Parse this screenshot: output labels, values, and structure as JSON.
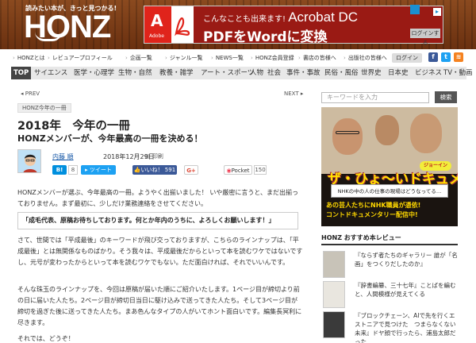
{
  "header": {
    "tagline": "読みたい本が、きっと見つかる!",
    "logo": "HONZ",
    "ad": {
      "brand": "Adobe",
      "line1_prefix": "こんなことも出来ます!",
      "line1_product": "Acrobat DC",
      "line2": "PDFをWordに変換"
    },
    "login_top": "ログインする"
  },
  "topnav": {
    "items": [
      "HONZとは",
      "レビュアープロフィール",
      "企画一覧",
      "ジャンル一覧",
      "NEWS一覧",
      "HONZ会員登録",
      "書店の皆様へ",
      "出版社の皆様へ"
    ],
    "login": "ログイン"
  },
  "categories": [
    "TOP",
    "サイエンス",
    "医学・心理学",
    "生物・自然",
    "教養・雑学",
    "アート・スポーツ",
    "人物",
    "社会",
    "事件・事故",
    "民俗・風俗",
    "世界史",
    "日本史",
    "ビジネス",
    "TV・動画"
  ],
  "pager": {
    "prev": "PREV",
    "next": "NEXT"
  },
  "article": {
    "tag": "HONZ今年の一冊",
    "title": "2018年　今年の一冊",
    "subtitle": "HONZメンバーが、今年最高の一冊を決める！",
    "author": "内藤 順",
    "date": "2018年12月29日",
    "print": "印刷",
    "share": {
      "hatena": "B!",
      "hatena_count": "8",
      "tweet": "ツイート",
      "like": "いいね！",
      "like_count": "591",
      "gplus": "G+",
      "pocket": "Pocket",
      "pocket_count": "150"
    },
    "p1": "HONZメンバーが選ぶ、今年最高の一冊。ようやく出揃いました！ いや厳密に言うと、まだ出揃っておりません。まず最初に、少しだけ業務連絡をさせてください。",
    "quote": "「成毛代表、原稿お待ちしております。何とか年内のうちに、よろしくお願いします！」",
    "p2": "さて、世間では「平成最後」のキーワードが飛び交っておりますが、こちらのラインナップは、「平成最後」とは無関係なものばかり。そう我々は、平成最後だからといって本を読むワケではないですし、元号が変わったからといって本を読むワケでもない。ただ面白ければ、それでいいんです。",
    "p3": "そんな珠玉のラインナップを、今回は原稿が届いた順にご紹介いたします。1ページ目が締切より前の日に届いた人たち。2ページ目が締切日当日に駆け込みで送ってきた人たち。そして3ページ目が締切を過ぎた後に送ってきた人たち。まあ色んなタイプの人がいてホント面白いです。編集長冥利に尽きます。",
    "p4": "それでは、どうぞ！"
  },
  "sidebar": {
    "search_placeholder": "キーワードを入力",
    "search_button": "検索",
    "ad": {
      "badge": "ジョーイン",
      "title": "ザ・ひょ〜いドキュメント",
      "subtitle": "NHKの中の人の仕事の現場はどうなってる…",
      "bottom_line1": "あの芸人たちにNHK職員が憑依!",
      "bottom_line2": "コントドキュメンタリー配信中!"
    },
    "review_heading_prefix": "HONZ",
    "review_heading": "おすすめ本レビュー",
    "reviews": [
      "『ならず者たちのギャラリー 誰が「名画」をつくりだしたのか』",
      "『辞書編纂、三十七年』ことばを編むと、人間模様が見えてくる",
      "『ブロックチェーン、AIで先を行くエストニアで見つけた　つまらなくない未来』ドヤ顔で行ったら、浦島太郎だった"
    ]
  },
  "colors": {
    "header_brown": "#7a3b16",
    "ad_red": "#e0241b",
    "active_cat": "#444444",
    "link_blue": "#1a5aa8",
    "facebook": "#3b5998",
    "twitter": "#1da1f2",
    "hatena": "#008fde",
    "gplus": "#dd4b39",
    "pocket": "#ef4056"
  }
}
